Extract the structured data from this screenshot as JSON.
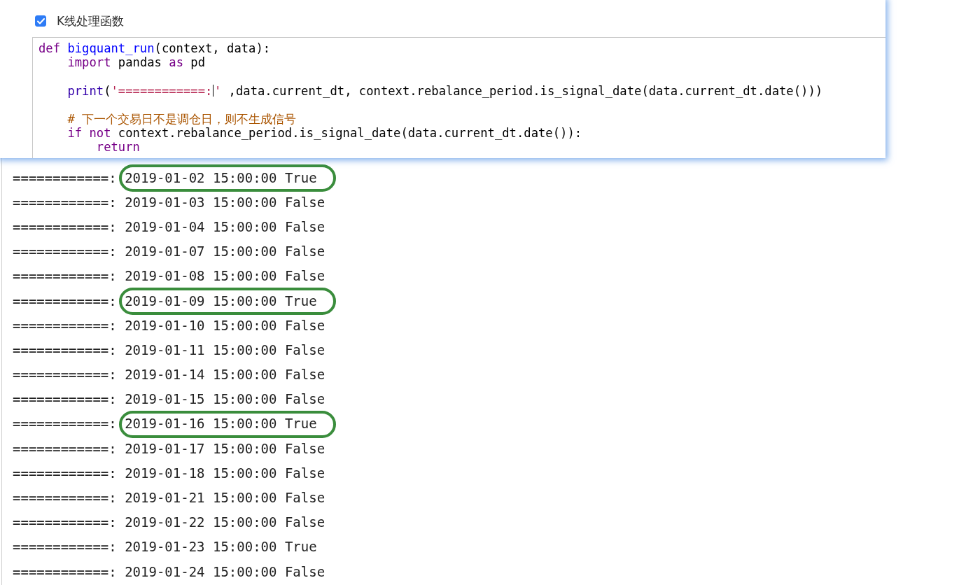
{
  "code_cell": {
    "checkbox": {
      "label": "K线处理函数",
      "checked": true
    },
    "code_lines": [
      {
        "kind": "code",
        "tokens": [
          {
            "kind": "keyword",
            "text": "def"
          },
          {
            "kind": "def",
            "text": " bigquant_run"
          },
          {
            "kind": "plain",
            "text": "(context, data):"
          }
        ]
      },
      {
        "kind": "code",
        "tokens": [
          {
            "kind": "keyword",
            "text": "    import"
          },
          {
            "kind": "plain",
            "text": " pandas "
          },
          {
            "kind": "keyword",
            "text": "as"
          },
          {
            "kind": "plain",
            "text": " pd"
          }
        ]
      },
      {
        "kind": "blank"
      },
      {
        "kind": "code",
        "tokens": [
          {
            "kind": "builtin",
            "text": "    print"
          },
          {
            "kind": "plain",
            "text": "("
          },
          {
            "kind": "string",
            "text": "'============:"
          },
          {
            "kind": "cursor"
          },
          {
            "kind": "string",
            "text": "'"
          },
          {
            "kind": "plain",
            "text": " ,data.current_dt, context.rebalance_period.is_signal_date(data.current_dt.date()))"
          }
        ]
      },
      {
        "kind": "blank"
      },
      {
        "kind": "code",
        "tokens": [
          {
            "kind": "comment",
            "text": "    # 下一个交易日不是调仓日，则不生成信号"
          }
        ]
      },
      {
        "kind": "code",
        "tokens": [
          {
            "kind": "keyword",
            "text": "    if not"
          },
          {
            "kind": "plain",
            "text": " context.rebalance_period.is_signal_date(data.current_dt.date()):"
          }
        ]
      },
      {
        "kind": "code",
        "tokens": [
          {
            "kind": "keyword",
            "text": "        return"
          }
        ]
      }
    ]
  },
  "output_lines": [
    {
      "text": "============: 2019-01-02 15:00:00 True",
      "highlighted": true
    },
    {
      "text": "============: 2019-01-03 15:00:00 False",
      "highlighted": false
    },
    {
      "text": "============: 2019-01-04 15:00:00 False",
      "highlighted": false
    },
    {
      "text": "============: 2019-01-07 15:00:00 False",
      "highlighted": false
    },
    {
      "text": "============: 2019-01-08 15:00:00 False",
      "highlighted": false
    },
    {
      "text": "============: 2019-01-09 15:00:00 True",
      "highlighted": true
    },
    {
      "text": "============: 2019-01-10 15:00:00 False",
      "highlighted": false
    },
    {
      "text": "============: 2019-01-11 15:00:00 False",
      "highlighted": false
    },
    {
      "text": "============: 2019-01-14 15:00:00 False",
      "highlighted": false
    },
    {
      "text": "============: 2019-01-15 15:00:00 False",
      "highlighted": false
    },
    {
      "text": "============: 2019-01-16 15:00:00 True",
      "highlighted": true
    },
    {
      "text": "============: 2019-01-17 15:00:00 False",
      "highlighted": false
    },
    {
      "text": "============: 2019-01-18 15:00:00 False",
      "highlighted": false
    },
    {
      "text": "============: 2019-01-21 15:00:00 False",
      "highlighted": false
    },
    {
      "text": "============: 2019-01-22 15:00:00 False",
      "highlighted": false
    },
    {
      "text": "============: 2019-01-23 15:00:00 True",
      "highlighted": false
    },
    {
      "text": "============: 2019-01-24 15:00:00 False",
      "highlighted": false
    }
  ]
}
